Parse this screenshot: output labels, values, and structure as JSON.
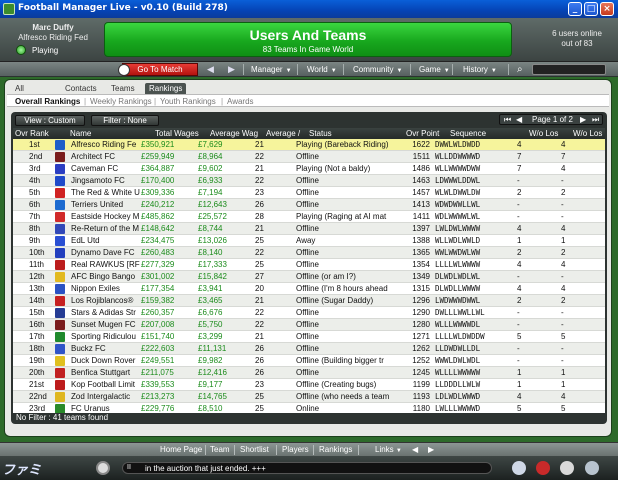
{
  "window": {
    "title": "Football Manager Live - v0.10 (Build 278)"
  },
  "header": {
    "manager_name": "Marc Duffy",
    "manager_club": "Alfresco Riding Fed",
    "status": "Playing",
    "banner_title": "Users And Teams",
    "banner_subtitle": "83 Teams In Game World",
    "users_online_line1": "6 users online",
    "users_online_line2": "out of 83"
  },
  "nav": {
    "goto_match": "Go To Match",
    "menus": [
      "Manager",
      "World",
      "Community",
      "Game",
      "History"
    ]
  },
  "tabs": [
    "All Users",
    "Contacts",
    "Teams",
    "Rankings"
  ],
  "active_tab": "Rankings",
  "subtabs": [
    "Overall Rankings",
    "Weekly Rankings",
    "Youth Rankings",
    "Awards"
  ],
  "toolbar": {
    "view_button": "View : Custom",
    "filter_button": "Filter : None",
    "pager_text": "Page 1 of 2"
  },
  "columns": [
    "Ovr Rank",
    "Name",
    "Total Wages",
    "Average Wag",
    "Average /",
    "Status",
    "Ovr Point",
    "Sequence",
    "W/o Los",
    "W/o Los"
  ],
  "rows": [
    {
      "rank": "1st",
      "name": "Alfresco Riding Fe",
      "wages": "£350,921",
      "avgw": "£7,629",
      "avga": "21",
      "status": "Playing (Bareback Riding)",
      "ovr": "1622",
      "seq": "DWWLWLDWDD",
      "wl1": "4",
      "wl2": "4",
      "kit": "#1d5fc8",
      "selected": true
    },
    {
      "rank": "2nd",
      "name": "Architect FC",
      "wages": "£259,949",
      "avgw": "£8,964",
      "avga": "22",
      "status": "Offline",
      "ovr": "1511",
      "seq": "WLLDDWWWWD",
      "wl1": "7",
      "wl2": "7",
      "kit": "#7a1c1c"
    },
    {
      "rank": "3rd",
      "name": "Caveman FC",
      "wages": "£364,887",
      "avgw": "£9,602",
      "avga": "21",
      "status": "Playing (Not a baldy)",
      "ovr": "1486",
      "seq": "WLLWWWWDWW",
      "wl1": "7",
      "wl2": "4",
      "kit": "#2b3ec2"
    },
    {
      "rank": "4th",
      "name": "Jingsamoto FC",
      "wages": "£170,400",
      "avgw": "£6,933",
      "avga": "22",
      "status": "Offline",
      "ovr": "1463",
      "seq": "LDWWWLDDWL",
      "wl1": "-",
      "wl2": "-",
      "kit": "#1f49c9"
    },
    {
      "rank": "5th",
      "name": "The Red & White U",
      "wages": "£309,336",
      "avgw": "£7,194",
      "avga": "23",
      "status": "Offline",
      "ovr": "1457",
      "seq": "WLWLDWWLDW",
      "wl1": "2",
      "wl2": "2",
      "kit": "#d02323"
    },
    {
      "rank": "6th",
      "name": "Terriers United",
      "wages": "£240,212",
      "avgw": "£12,643",
      "avga": "26",
      "status": "Offline",
      "ovr": "1413",
      "seq": "WDWDWWLLWL",
      "wl1": "-",
      "wl2": "-",
      "kit": "#1d6bd0"
    },
    {
      "rank": "7th",
      "name": "Eastside Hockey M",
      "wages": "£485,862",
      "avgw": "£25,572",
      "avga": "28",
      "status": "Playing (Raging at AI mat",
      "ovr": "1411",
      "seq": "WDLWWWWLWL",
      "wl1": "-",
      "wl2": "-",
      "kit": "#d12a2a"
    },
    {
      "rank": "8th",
      "name": "Re-Return of the M",
      "wages": "£148,642",
      "avgw": "£8,744",
      "avga": "21",
      "status": "Offline",
      "ovr": "1397",
      "seq": "LWLDWLWWWW",
      "wl1": "4",
      "wl2": "4",
      "kit": "#3148b8"
    },
    {
      "rank": "9th",
      "name": "EdL Utd",
      "wages": "£234,475",
      "avgw": "£13,026",
      "avga": "25",
      "status": "Away",
      "ovr": "1388",
      "seq": "WLLWDLWWLD",
      "wl1": "1",
      "wl2": "1",
      "kit": "#2a4fd3"
    },
    {
      "rank": "10th",
      "name": "Dynamo Dave FC",
      "wages": "£260,483",
      "avgw": "£8,140",
      "avga": "22",
      "status": "Offline",
      "ovr": "1365",
      "seq": "WWLWWDWLWW",
      "wl1": "2",
      "wl2": "2",
      "kit": "#233fbe"
    },
    {
      "rank": "11th",
      "name": "Real RAWKUS [RF",
      "wages": "£277,329",
      "avgw": "£17,333",
      "avga": "25",
      "status": "Offline",
      "ovr": "1354",
      "seq": "LLLLWLWWWW",
      "wl1": "4",
      "wl2": "4",
      "kit": "#bc1d1d"
    },
    {
      "rank": "12th",
      "name": "AFC Bingo Bango",
      "wages": "£301,002",
      "avgw": "£15,842",
      "avga": "27",
      "status": "Offline (or am I?)",
      "ovr": "1349",
      "seq": "DLWDLWDLWL",
      "wl1": "-",
      "wl2": "-",
      "kit": "#e2b91f"
    },
    {
      "rank": "13th",
      "name": "Nippon Exiles",
      "wages": "£177,354",
      "avgw": "£3,941",
      "avga": "20",
      "status": "Offline (I'm 8 hours ahead",
      "ovr": "1315",
      "seq": "DLWDLLWWWW",
      "wl1": "4",
      "wl2": "4",
      "kit": "#2a52c4"
    },
    {
      "rank": "14th",
      "name": "Los Rojiblancos®",
      "wages": "£159,382",
      "avgw": "£3,465",
      "avga": "21",
      "status": "Offline (Sugar Daddy)",
      "ovr": "1296",
      "seq": "LWDWWWDWWL",
      "wl1": "2",
      "wl2": "2",
      "kit": "#c62020"
    },
    {
      "rank": "15th",
      "name": "Stars & Adidas Str",
      "wages": "£260,357",
      "avgw": "£6,676",
      "avga": "22",
      "status": "Offline",
      "ovr": "1290",
      "seq": "DWLLLWWLLWL",
      "wl1": "-",
      "wl2": "-",
      "kit": "#263c94"
    },
    {
      "rank": "16th",
      "name": "Sunset Mugen FC",
      "wages": "£207,008",
      "avgw": "£5,750",
      "avga": "22",
      "status": "Offline",
      "ovr": "1280",
      "seq": "WLLLWWWWDL",
      "wl1": "-",
      "wl2": "-",
      "kit": "#7a1c1c"
    },
    {
      "rank": "17th",
      "name": "Sporting Ridiculou",
      "wages": "£151,740",
      "avgw": "£3,299",
      "avga": "21",
      "status": "Offline",
      "ovr": "1271",
      "seq": "LLLLWLDWDDW",
      "wl1": "5",
      "wl2": "5",
      "kit": "#1f8a2c"
    },
    {
      "rank": "18th",
      "name": "Buckz FC",
      "wages": "£222,603",
      "avgw": "£11,131",
      "avga": "26",
      "status": "Offline",
      "ovr": "1262",
      "seq": "LLDWDWLLDL",
      "wl1": "-",
      "wl2": "-",
      "kit": "#2f55c9"
    },
    {
      "rank": "19th",
      "name": "Duck Down Rover",
      "wages": "£249,551",
      "avgw": "£9,982",
      "avga": "26",
      "status": "Offline (Building bigger tr",
      "ovr": "1252",
      "seq": "WWWLDWLWDL",
      "wl1": "-",
      "wl2": "-",
      "kit": "#e0c020"
    },
    {
      "rank": "20th",
      "name": "Benfica Stuttgart",
      "wages": "£211,075",
      "avgw": "£12,416",
      "avga": "26",
      "status": "Offline",
      "ovr": "1245",
      "seq": "WLLLLWWWWW",
      "wl1": "1",
      "wl2": "1",
      "kit": "#c12121"
    },
    {
      "rank": "21st",
      "name": "Kop Football Limit",
      "wages": "£339,553",
      "avgw": "£9,177",
      "avga": "23",
      "status": "Offline (Creating bugs)",
      "ovr": "1199",
      "seq": "LLDDDLLWLW",
      "wl1": "1",
      "wl2": "1",
      "kit": "#bd1c1c"
    },
    {
      "rank": "22nd",
      "name": "Zod Intergalactic",
      "wages": "£213,273",
      "avgw": "£14,765",
      "avga": "25",
      "status": "Offline (who needs a team",
      "ovr": "1193",
      "seq": "LDLWDLWWWD",
      "wl1": "4",
      "wl2": "4",
      "kit": "#dfb720"
    },
    {
      "rank": "23rd",
      "name": "FC Uranus",
      "wages": "£229,776",
      "avgw": "£8,510",
      "avga": "25",
      "status": "Online",
      "ovr": "1180",
      "seq": "LWLLLWWWWD",
      "wl1": "5",
      "wl2": "5",
      "kit": "#2a8a2a"
    }
  ],
  "grid_footer": "No Filter : 41 teams found",
  "bottom_nav": [
    "Home Page",
    "Team",
    "Shortlist",
    "Players",
    "Rankings",
    "Links"
  ],
  "ticker": {
    "pause": "II",
    "text": "in the auction that just ended.   +++"
  },
  "watermark": "ファミ通.com"
}
